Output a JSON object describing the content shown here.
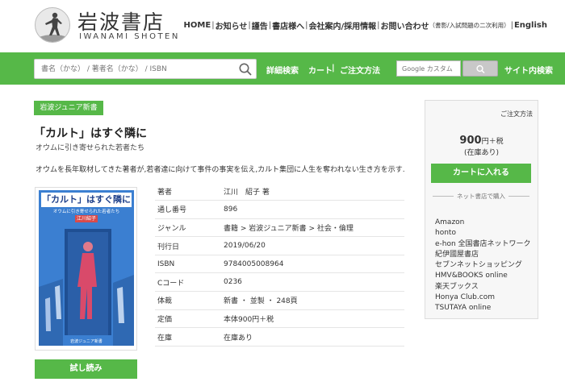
{
  "header": {
    "logo_title": "岩波書店",
    "logo_subtitle": "IWANAMI SHOTEN",
    "nav": {
      "home": "HOME",
      "news": "お知らせ",
      "magazine": "謹告",
      "to_stores": "書店様へ",
      "company": "会社案内/採用情報",
      "contact": "お問い合わせ",
      "contact_note": "（書影/入試問題の二次利用）",
      "english": "English"
    }
  },
  "searchbar": {
    "placeholder": "書名（かな） / 著者名（かな） / ISBN",
    "advanced_search": "詳細検索",
    "cart": "カート",
    "order_method": "ご注文方法",
    "google_placeholder": "Google カスタム",
    "site_search": "サイト内検索"
  },
  "book": {
    "series_badge": "岩波ジュニア新書",
    "title": "「カルト」はすぐ隣に",
    "subtitle": "オウムに引き寄せられた若者たち",
    "description": "オウムを長年取材してきた著者が,若者達に向けて事件の事実を伝え,カルト集団に人生を奪われない生き方を示す.",
    "cover": {
      "title": "「カルト」はすぐ隣に",
      "subtitle": "オウムに引き寄せられた若者たち",
      "author": "江川紹子",
      "label": "岩波ジュニア新書"
    },
    "trial_button": "試し読み",
    "info": [
      {
        "key": "著者",
        "value": "江川　紹子 著"
      },
      {
        "key": "通し番号",
        "value": "896"
      },
      {
        "key": "ジャンル",
        "value": "書籍 > 岩波ジュニア新書 > 社会・倫理"
      },
      {
        "key": "刊行日",
        "value": "2019/06/20"
      },
      {
        "key": "ISBN",
        "value": "9784005008964"
      },
      {
        "key": "Cコード",
        "value": "0236"
      },
      {
        "key": "体裁",
        "value": "新書 ・ 並製 ・ 248頁"
      },
      {
        "key": "定価",
        "value": "本体900円＋税"
      },
      {
        "key": "在庫",
        "value": "在庫あり"
      }
    ]
  },
  "sidebar": {
    "order_method": "ご注文方法",
    "price_number": "900",
    "price_unit": "円＋税",
    "stock": "(在庫あり)",
    "cart_button": "カートに入れる",
    "net_heading": "ネット書店で購入",
    "stores": [
      "Amazon",
      "honto",
      "e-hon 全国書店ネットワーク",
      "紀伊國屋書店",
      "セブンネットショッピング",
      "HMV&BOOKS online",
      "楽天ブックス",
      "Honya Club.com",
      "TSUTAYA online"
    ]
  },
  "colors": {
    "brand_green": "#56b848",
    "cover_blue": "#3b7fd1"
  }
}
